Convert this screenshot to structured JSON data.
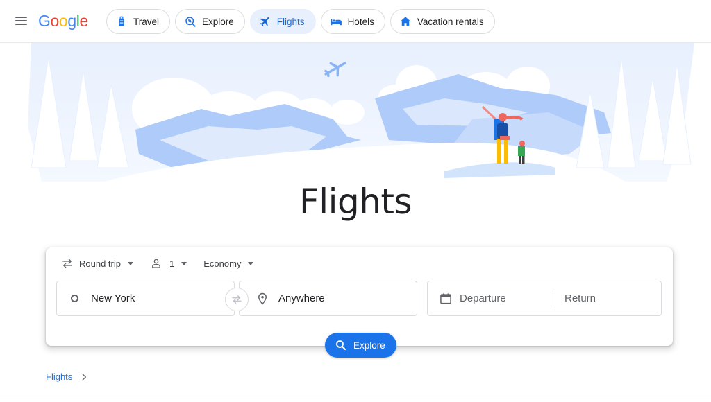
{
  "header": {
    "logo_letters": [
      {
        "ch": "G",
        "color": "#4285F4"
      },
      {
        "ch": "o",
        "color": "#EA4335"
      },
      {
        "ch": "o",
        "color": "#FBBC05"
      },
      {
        "ch": "g",
        "color": "#4285F4"
      },
      {
        "ch": "l",
        "color": "#34A853"
      },
      {
        "ch": "e",
        "color": "#EA4335"
      }
    ],
    "nav": [
      {
        "label": "Travel",
        "icon": "luggage-icon",
        "active": false
      },
      {
        "label": "Explore",
        "icon": "explore-icon",
        "active": false
      },
      {
        "label": "Flights",
        "icon": "airplane-icon",
        "active": true
      },
      {
        "label": "Hotels",
        "icon": "bed-icon",
        "active": false
      },
      {
        "label": "Vacation rentals",
        "icon": "house-icon",
        "active": false
      }
    ]
  },
  "page": {
    "title": "Flights"
  },
  "search": {
    "trip_type": "Round trip",
    "passengers": "1",
    "cabin_class": "Economy",
    "origin": "New York",
    "destination": "Anywhere",
    "departure_placeholder": "Departure",
    "return_placeholder": "Return",
    "explore_label": "Explore"
  },
  "breadcrumb": {
    "label": "Flights"
  },
  "colors": {
    "accent": "#1a73e8",
    "active_chip_bg": "#e8f0fe",
    "illustration_blue": "#aecbfa"
  }
}
